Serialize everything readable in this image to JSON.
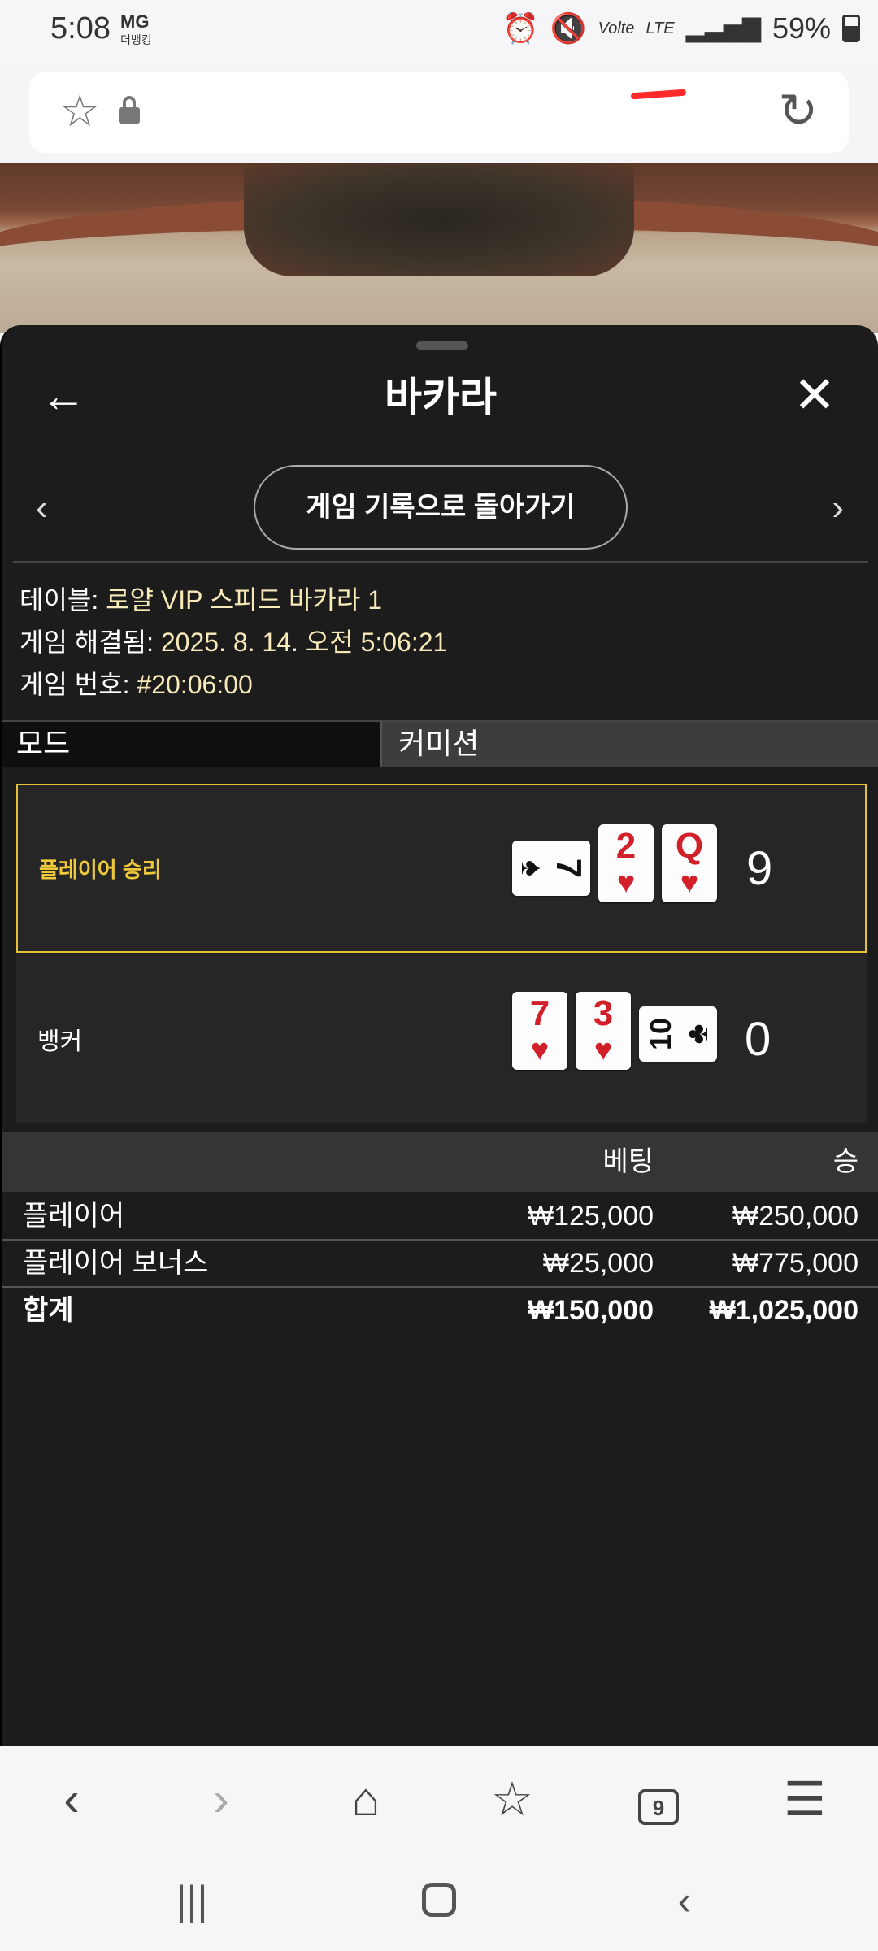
{
  "status": {
    "time": "5:08",
    "carrier_top": "MG",
    "carrier_bottom": "더뱅킹",
    "volte": "Volte",
    "network": "LTE",
    "battery": "59%"
  },
  "browser": {
    "icons": [
      "star-icon",
      "lock-icon",
      "refresh-icon"
    ]
  },
  "sheet": {
    "title": "바카라",
    "back_label": "←",
    "close_label": "✕",
    "prev_label": "‹",
    "next_label": "›",
    "history_button": "게임 기록으로 돌아가기",
    "info": {
      "table_label": "테이블:",
      "table_value": " 로얄 VIP 스피드 바카라 1",
      "resolved_label": "게임 해결됨:",
      "resolved_value": " 2025. 8. 14. 오전 5:06:21",
      "number_label": "게임 번호:",
      "number_value": " #20:06:00"
    },
    "mode": {
      "left": "모드",
      "right": "커미션"
    },
    "hands": {
      "player": {
        "label": "플레이어 승리",
        "score": "9",
        "cards": [
          {
            "rank": "7",
            "suit": "♠",
            "color": "black",
            "orientation": "sideways"
          },
          {
            "rank": "2",
            "suit": "♥",
            "color": "red",
            "orientation": "upright"
          },
          {
            "rank": "Q",
            "suit": "♥",
            "color": "red",
            "orientation": "upright"
          }
        ]
      },
      "banker": {
        "label": "뱅커",
        "score": "0",
        "cards": [
          {
            "rank": "7",
            "suit": "♥",
            "color": "red",
            "orientation": "upright"
          },
          {
            "rank": "3",
            "suit": "♥",
            "color": "red",
            "orientation": "upright"
          },
          {
            "rank": "10",
            "suit": "♣",
            "color": "black",
            "orientation": "sideways"
          }
        ]
      }
    },
    "bets": {
      "header_bet": "베팅",
      "header_win": "승",
      "rows": [
        {
          "name": "플레이어",
          "bet": "₩125,000",
          "win": "₩250,000"
        },
        {
          "name": "플레이어 보너스",
          "bet": "₩25,000",
          "win": "₩775,000"
        }
      ],
      "total": {
        "name": "합계",
        "bet": "₩150,000",
        "win": "₩1,025,000"
      }
    }
  },
  "bottom_nav": {
    "back": "‹",
    "forward": "›",
    "tabs_count": "9",
    "menu": "☰"
  }
}
